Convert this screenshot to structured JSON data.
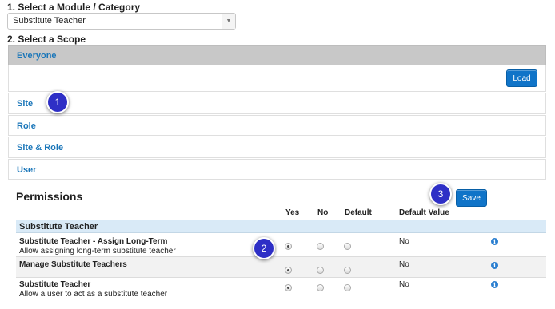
{
  "module_section": {
    "label": "1. Select a Module / Category",
    "selected_value": "Substitute Teacher"
  },
  "scope_section": {
    "label": "2. Select a Scope",
    "everyone": {
      "title": "Everyone",
      "load_label": "Load"
    },
    "scopes": [
      {
        "title": "Site"
      },
      {
        "title": "Role"
      },
      {
        "title": "Site & Role"
      },
      {
        "title": "User"
      }
    ]
  },
  "callouts": [
    "1",
    "2",
    "3"
  ],
  "permissions": {
    "heading": "Permissions",
    "save_label": "Save",
    "columns": {
      "yes": "Yes",
      "no": "No",
      "default": "Default",
      "default_value": "Default Value"
    },
    "group": "Substitute Teacher",
    "rows": [
      {
        "name": "Substitute Teacher - Assign Long-Term",
        "description": "Allow assigning long-term substitute teacher",
        "selected": "yes",
        "default_value": "No"
      },
      {
        "name": "Manage Substitute Teachers",
        "description": "",
        "selected": "yes",
        "default_value": "No"
      },
      {
        "name": "Substitute Teacher",
        "description": "Allow a user to act as a substitute teacher",
        "selected": "yes",
        "default_value": "No"
      }
    ]
  },
  "icons": {
    "dropdown": "chevron-down-icon",
    "info": "info-icon"
  },
  "colors": {
    "accent": "#1074c8",
    "link": "#1a76b9",
    "callout": "#2e2fc6",
    "group_row": "#d9eaf7"
  }
}
